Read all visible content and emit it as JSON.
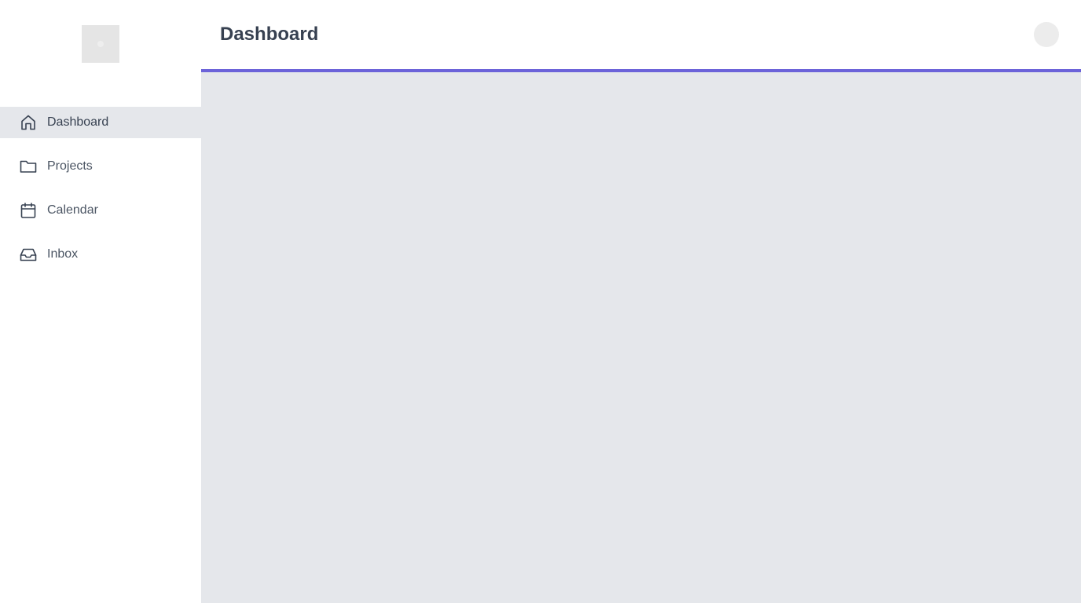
{
  "header": {
    "title": "Dashboard"
  },
  "sidebar": {
    "items": [
      {
        "label": "Dashboard",
        "icon": "home-icon",
        "active": true
      },
      {
        "label": "Projects",
        "icon": "folder-icon",
        "active": false
      },
      {
        "label": "Calendar",
        "icon": "calendar-icon",
        "active": false
      },
      {
        "label": "Inbox",
        "icon": "inbox-icon",
        "active": false
      }
    ]
  },
  "colors": {
    "accent": "#6c63d9",
    "active_nav_bg": "#e5e7eb",
    "main_bg": "#e5e7eb",
    "text": "#374151"
  }
}
